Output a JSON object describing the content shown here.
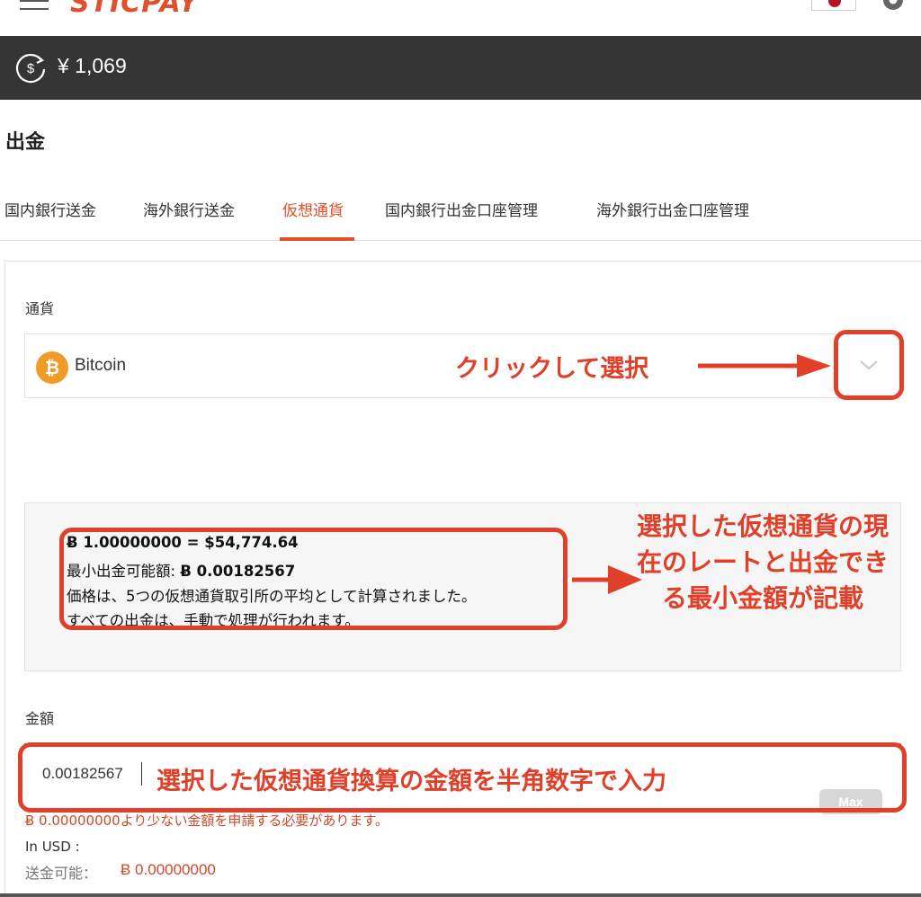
{
  "header": {
    "logo_text": "STICPAY",
    "flag": "jp-flag",
    "menu_icon": "hamburger-icon",
    "settings_icon": "gear-icon"
  },
  "balance": {
    "icon": "dollar-exchange-icon",
    "amount": "¥ 1,069"
  },
  "page": {
    "title": "出金"
  },
  "tabs": [
    {
      "label": "国内銀行送金",
      "active": false
    },
    {
      "label": "海外銀行送金",
      "active": false
    },
    {
      "label": "仮想通貨",
      "active": true
    },
    {
      "label": "国内銀行出金口座管理",
      "active": false
    },
    {
      "label": "海外銀行出金口座管理",
      "active": false
    }
  ],
  "form": {
    "currency_label": "通貨",
    "currency_selected": "Bitcoin",
    "currency_icon": "bitcoin-icon",
    "info": {
      "rate": "Ƀ 1.00000000 = $54,774.64",
      "min_label": "最小出金可能額:",
      "min_value": "Ƀ 0.00182567",
      "note1": "価格は、5つの仮想通貨取引所の平均として計算されました。",
      "note2": "すべての出金は、手動で処理が行われます。"
    },
    "amount_label": "金額",
    "amount_value": "0.00182567",
    "max_label": "Max",
    "error": "Ƀ 0.00000000より少ない金額を申請する必要があります。",
    "usd_label": "In USD :",
    "available_label": "送金可能：",
    "available_value": "Ƀ 0.00000000"
  },
  "annotations": {
    "select_hint": "クリックして選択",
    "rate_hint": "選択した仮想通貨の現在のレートと出金できる最小金額が記載",
    "amount_hint": "選択した仮想通貨換算の金額を半角数字で入力"
  },
  "colors": {
    "accent": "#e0502a",
    "annotation": "#e0402a",
    "balance_bar": "#353535",
    "bitcoin": "#f09a28"
  }
}
